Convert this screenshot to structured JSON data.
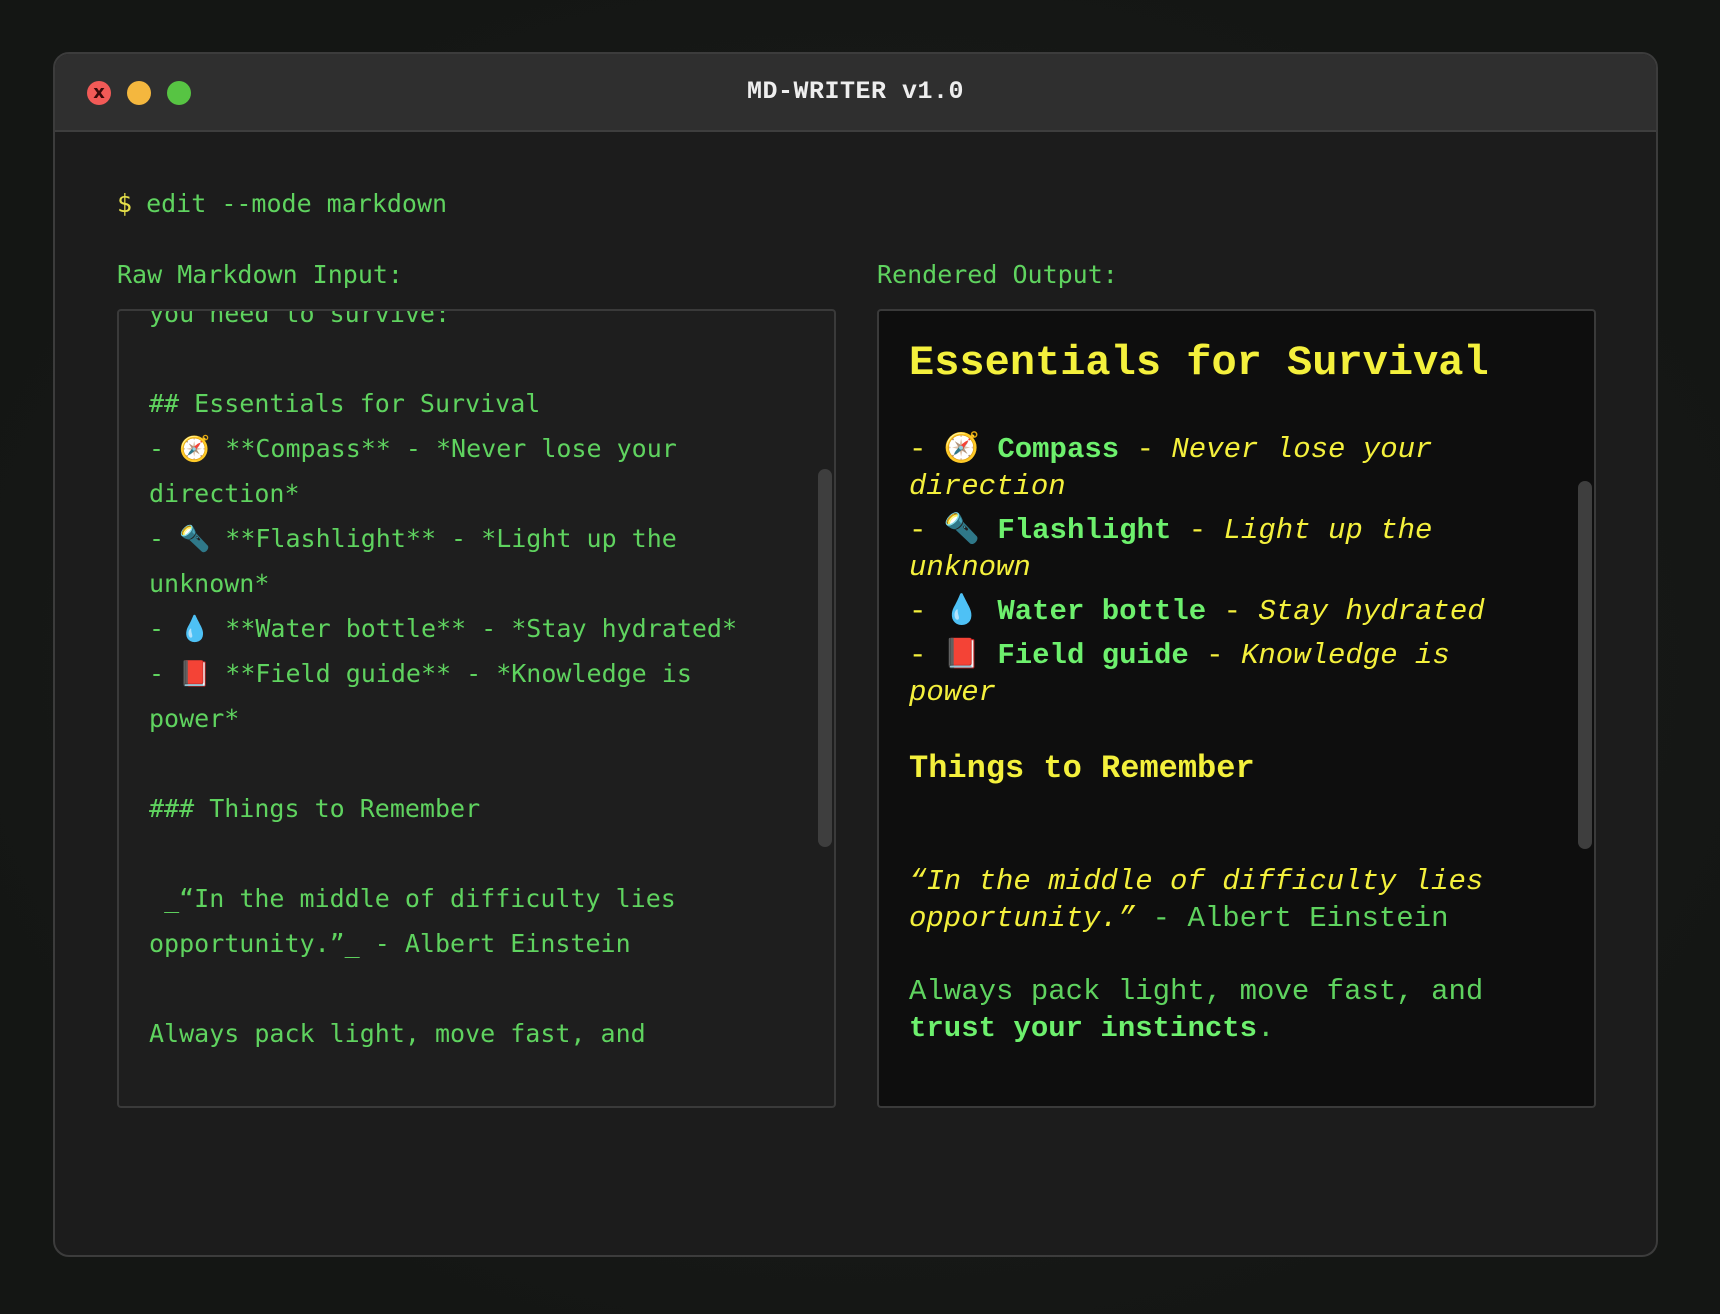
{
  "window": {
    "title": "MD-WRITER v1.0",
    "close_symbol": "x"
  },
  "prompt": {
    "symbol": "$",
    "command": "edit --mode markdown"
  },
  "labels": {
    "input": "Raw Markdown Input:",
    "output": "Rendered Output:"
  },
  "raw_markdown": "you need to survive:\n\n## Essentials for Survival\n- 🧭 **Compass** - *Never lose your direction*\n- 🔦 **Flashlight** - *Light up the unknown*\n- 💧 **Water bottle** - *Stay hydrated*\n- 📕 **Field guide** - *Knowledge is power*\n\n### Things to Remember\n\n _“In the middle of difficulty lies opportunity.”_ - Albert Einstein\n\nAlways pack light, move fast, and",
  "rendered": {
    "heading": "Essentials for Survival",
    "items": [
      {
        "dash": "-",
        "emoji": "🧭",
        "bold": "Compass",
        "sep": "-",
        "italic": "Never lose your direction"
      },
      {
        "dash": "-",
        "emoji": "🔦",
        "bold": "Flashlight",
        "sep": "-",
        "italic": "Light up the unknown"
      },
      {
        "dash": "-",
        "emoji": "💧",
        "bold": "Water bottle",
        "sep": "-",
        "italic": "Stay hydrated"
      },
      {
        "dash": "-",
        "emoji": "📕",
        "bold": "Field guide",
        "sep": "-",
        "italic": "Knowledge is power"
      }
    ],
    "subheading": "Things to Remember",
    "quote": {
      "text": "“In the middle of difficulty lies opportunity.”",
      "attribution": " - Albert Einstein"
    },
    "paragraph": {
      "text": "Always pack light, move fast, and ",
      "bold": "trust your instincts",
      "end": "."
    }
  },
  "colors": {
    "terminal_green": "#5fd35f",
    "heading_yellow": "#f4f03c",
    "close": "#f25a57",
    "minimize": "#f4b73e",
    "maximize": "#57c443"
  }
}
